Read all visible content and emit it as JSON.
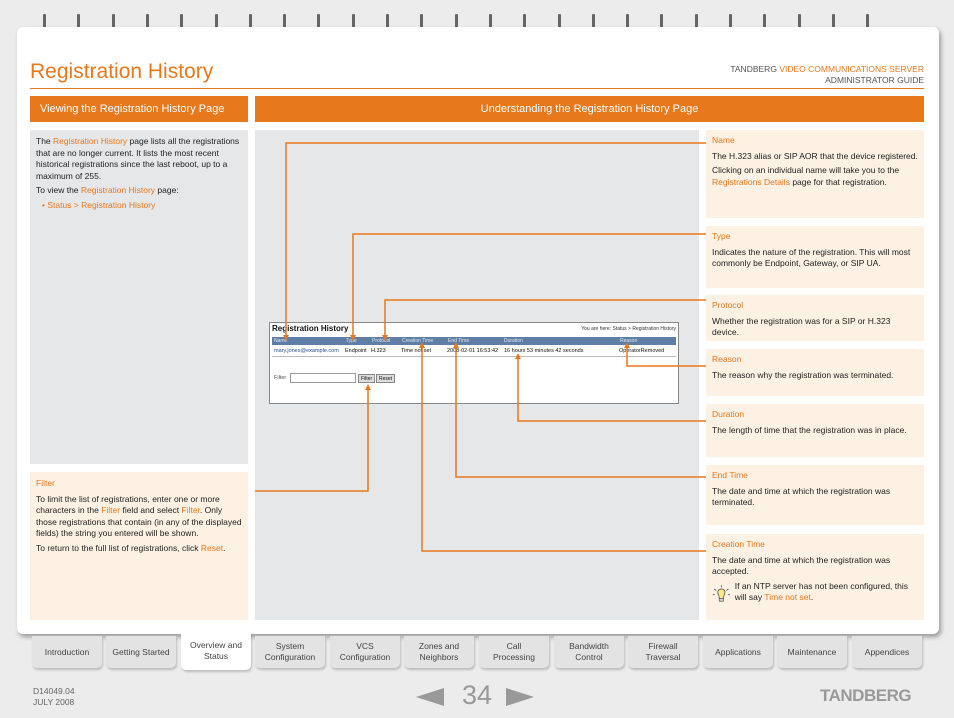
{
  "header": {
    "page_title": "Registration History",
    "brand": "TANDBERG",
    "product": "VIDEO COMMUNICATIONS SERVER",
    "guide": "ADMINISTRATOR GUIDE"
  },
  "left_bar": "Viewing the Registration History Page",
  "right_bar": "Understanding the Registration History Page",
  "intro": {
    "p1_a": "The ",
    "p1_link": "Registration History",
    "p1_b": " page lists all the registrations that are no longer current.  It lists the most recent historical registrations since the last reboot, up to a maximum of 255.",
    "p2_a": "To view the ",
    "p2_link": "Registration History",
    "p2_b": " page:",
    "bullet": "Status > Registration History"
  },
  "filter_box": {
    "heading": "Filter",
    "p1_a": "To limit the list of registrations, enter one or more characters in the ",
    "p1_link1": "Filter",
    "p1_b": " field and select ",
    "p1_link2": "Filter",
    "p1_c": ".  Only those registrations that contain (in any of the displayed fields) the string you entered will be shown.",
    "p2_a": "To return to the full list of registrations, click ",
    "p2_link": "Reset",
    "p2_b": "."
  },
  "screenshot": {
    "title": "Registration History",
    "you_are_here": "You are here: Status > Registration History",
    "columns": [
      "Name",
      "Type",
      "Protocol",
      "Creation Time",
      "End Time",
      "Duration",
      "Reason"
    ],
    "row": [
      "mary.jones@example.com",
      "Endpoint",
      "H.323",
      "Time not set",
      "2008-02-01 16:53:42",
      "16 hours 53 minutes 42 seconds",
      "OperatorRemoved"
    ],
    "filter_label": "Filter",
    "filter_button": "Filter",
    "reset_button": "Reset"
  },
  "right_boxes": {
    "name": {
      "heading": "Name",
      "p1": "The H.323 alias or SIP AOR that the device registered.",
      "p2_a": "Clicking on an individual name will take you to the ",
      "p2_link": "Registrations Details",
      "p2_b": " page for that registration."
    },
    "type": {
      "heading": "Type",
      "p1": "Indicates the nature of the registration.  This will most commonly be Endpoint, Gateway, or SIP UA."
    },
    "protocol": {
      "heading": "Protocol",
      "p1": "Whether the registration was for a SIP or H.323 device."
    },
    "reason": {
      "heading": "Reason",
      "p1": "The reason why the registration was terminated."
    },
    "duration": {
      "heading": "Duration",
      "p1": "The length of time that the registration was in place."
    },
    "end_time": {
      "heading": "End Time",
      "p1": "The date and time at which the registration was terminated."
    },
    "creation_time": {
      "heading": "Creation Time",
      "p1": "The date and time at which the registration was accepted.",
      "tip_a": "If an NTP server has not been configured, this will say ",
      "tip_link": "Time not set",
      "tip_b": "."
    }
  },
  "tabs": [
    "Introduction",
    "Getting Started",
    "Overview and Status",
    "System Configuration",
    "VCS Configuration",
    "Zones and Neighbors",
    "Call Processing",
    "Bandwidth Control",
    "Firewall Traversal",
    "Applications",
    "Maintenance",
    "Appendices"
  ],
  "footer": {
    "doc_id": "D14049.04",
    "date": "JULY 2008",
    "page_number": "34",
    "logo": "TANDBERG"
  },
  "colors": {
    "accent": "#e8781c",
    "panel": "#e6e7e9",
    "callout": "#fdf1e3"
  }
}
